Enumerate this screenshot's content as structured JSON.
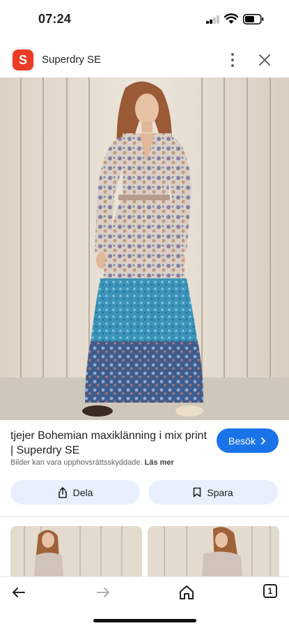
{
  "status": {
    "time": "07:24"
  },
  "header": {
    "logo_letter": "S",
    "site_name": "Superdry SE",
    "icons": [
      "more-vert-icon",
      "close-icon"
    ]
  },
  "result": {
    "title": "tjejer Bohemian maxiklänning i mix print | Superdry SE",
    "visit_label": "Besök",
    "copyright_text": "Bilder kan vara upphovsrättsskyddade.",
    "learn_more": "Läs mer"
  },
  "actions": {
    "share_label": "Dela",
    "save_label": "Spara"
  },
  "nav": {
    "tab_count": "1",
    "icons": [
      "back-arrow-icon",
      "forward-arrow-icon",
      "home-icon",
      "tabs-icon"
    ]
  },
  "colors": {
    "accent": "#1a73e8",
    "action_bg": "#e8f0fe",
    "logo_red": "#ea3b24"
  }
}
